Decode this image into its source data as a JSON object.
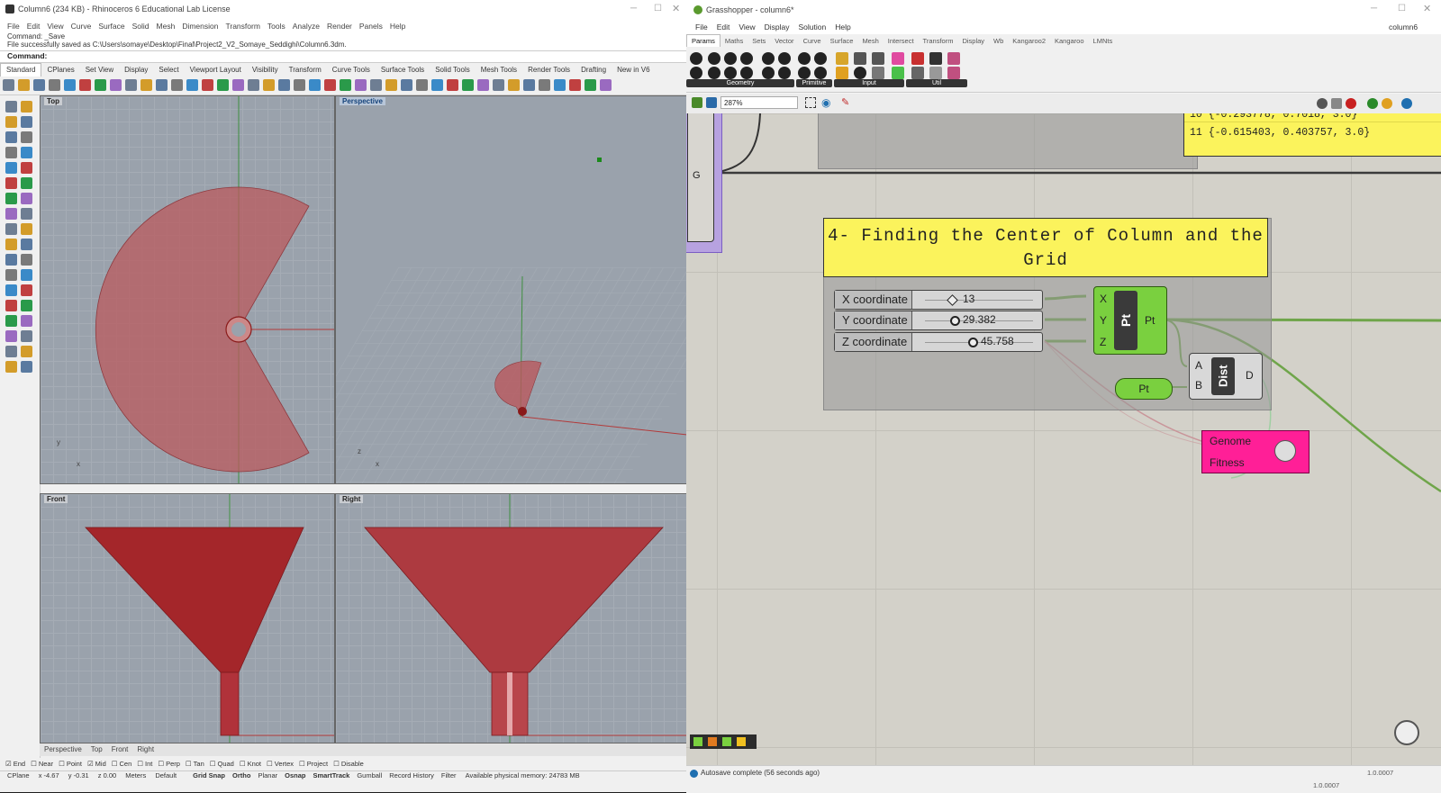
{
  "rhino": {
    "title": "Column6 (234 KB) - Rhinoceros 6 Educational Lab License",
    "menu": [
      "File",
      "Edit",
      "View",
      "Curve",
      "Surface",
      "Solid",
      "Mesh",
      "Dimension",
      "Transform",
      "Tools",
      "Analyze",
      "Render",
      "Panels",
      "Help"
    ],
    "history": [
      "Command: _Save",
      "File successfully saved as C:\\Users\\somaye\\Desktop\\Final\\Project2_V2_Somaye_Seddighi\\Column6.3dm."
    ],
    "command_label": "Command:",
    "tool_tabs": [
      "Standard",
      "CPlanes",
      "Set View",
      "Display",
      "Select",
      "Viewport Layout",
      "Visibility",
      "Transform",
      "Curve Tools",
      "Surface Tools",
      "Solid Tools",
      "Mesh Tools",
      "Render Tools",
      "Drafting",
      "New in V6"
    ],
    "viewports": {
      "top": "Top",
      "perspective": "Perspective",
      "front": "Front",
      "right": "Right"
    },
    "viewport_tabs": [
      "Perspective",
      "Top",
      "Front",
      "Right"
    ],
    "osnaps": [
      "End",
      "Near",
      "Point",
      "Mid",
      "Cen",
      "Int",
      "Perp",
      "Tan",
      "Quad",
      "Knot",
      "Vertex",
      "Project",
      "Disable"
    ],
    "osnaps_checked": [
      "End",
      "Mid"
    ],
    "status": {
      "cplane": "CPlane",
      "x": "x -4.67",
      "y": "y -0.31",
      "z": "z 0.00",
      "units": "Meters",
      "layer": "Default",
      "toggles": [
        "Grid Snap",
        "Ortho",
        "Planar",
        "Osnap",
        "SmartTrack",
        "Gumball",
        "Record History",
        "Filter"
      ],
      "memory": "Available physical memory: 24783 MB"
    },
    "axis_labels": {
      "x": "x",
      "y": "y",
      "z": "z"
    }
  },
  "gh": {
    "title": "Grasshopper - column6*",
    "doc_name": "column6",
    "menu": [
      "File",
      "Edit",
      "View",
      "Display",
      "Solution",
      "Help"
    ],
    "tabs": [
      "Params",
      "Maths",
      "Sets",
      "Vector",
      "Curve",
      "Surface",
      "Mesh",
      "Intersect",
      "Transform",
      "Display",
      "Wb",
      "Kangaroo2",
      "Kangaroo",
      "LMNts"
    ],
    "groups": [
      "Geometry",
      "Primitive",
      "Input",
      "Util"
    ],
    "zoom": "287%",
    "panel_rows": [
      "10 {-0.293778, 0.7018, 3.0}",
      "11 {-0.615403, 0.403757, 3.0}"
    ],
    "group_label": "G",
    "note_title": "4- Finding the Center of Column and the Grid",
    "sliders": [
      {
        "label": "X coordinate",
        "value": "13"
      },
      {
        "label": "Y coordinate",
        "value": "29.382"
      },
      {
        "label": "Z coordinate",
        "value": "45.758"
      }
    ],
    "pt_component": {
      "inputs": [
        "X",
        "Y",
        "Z"
      ],
      "name": "Pt",
      "output": "Pt"
    },
    "pt_param": "Pt",
    "dist_component": {
      "inputs": [
        "A",
        "B"
      ],
      "name": "Dist",
      "output": "D"
    },
    "genome": {
      "line1": "Genome",
      "line2": "Fitness"
    },
    "autosave": "Autosave complete (56 seconds ago)",
    "version": "1.0.0007"
  }
}
